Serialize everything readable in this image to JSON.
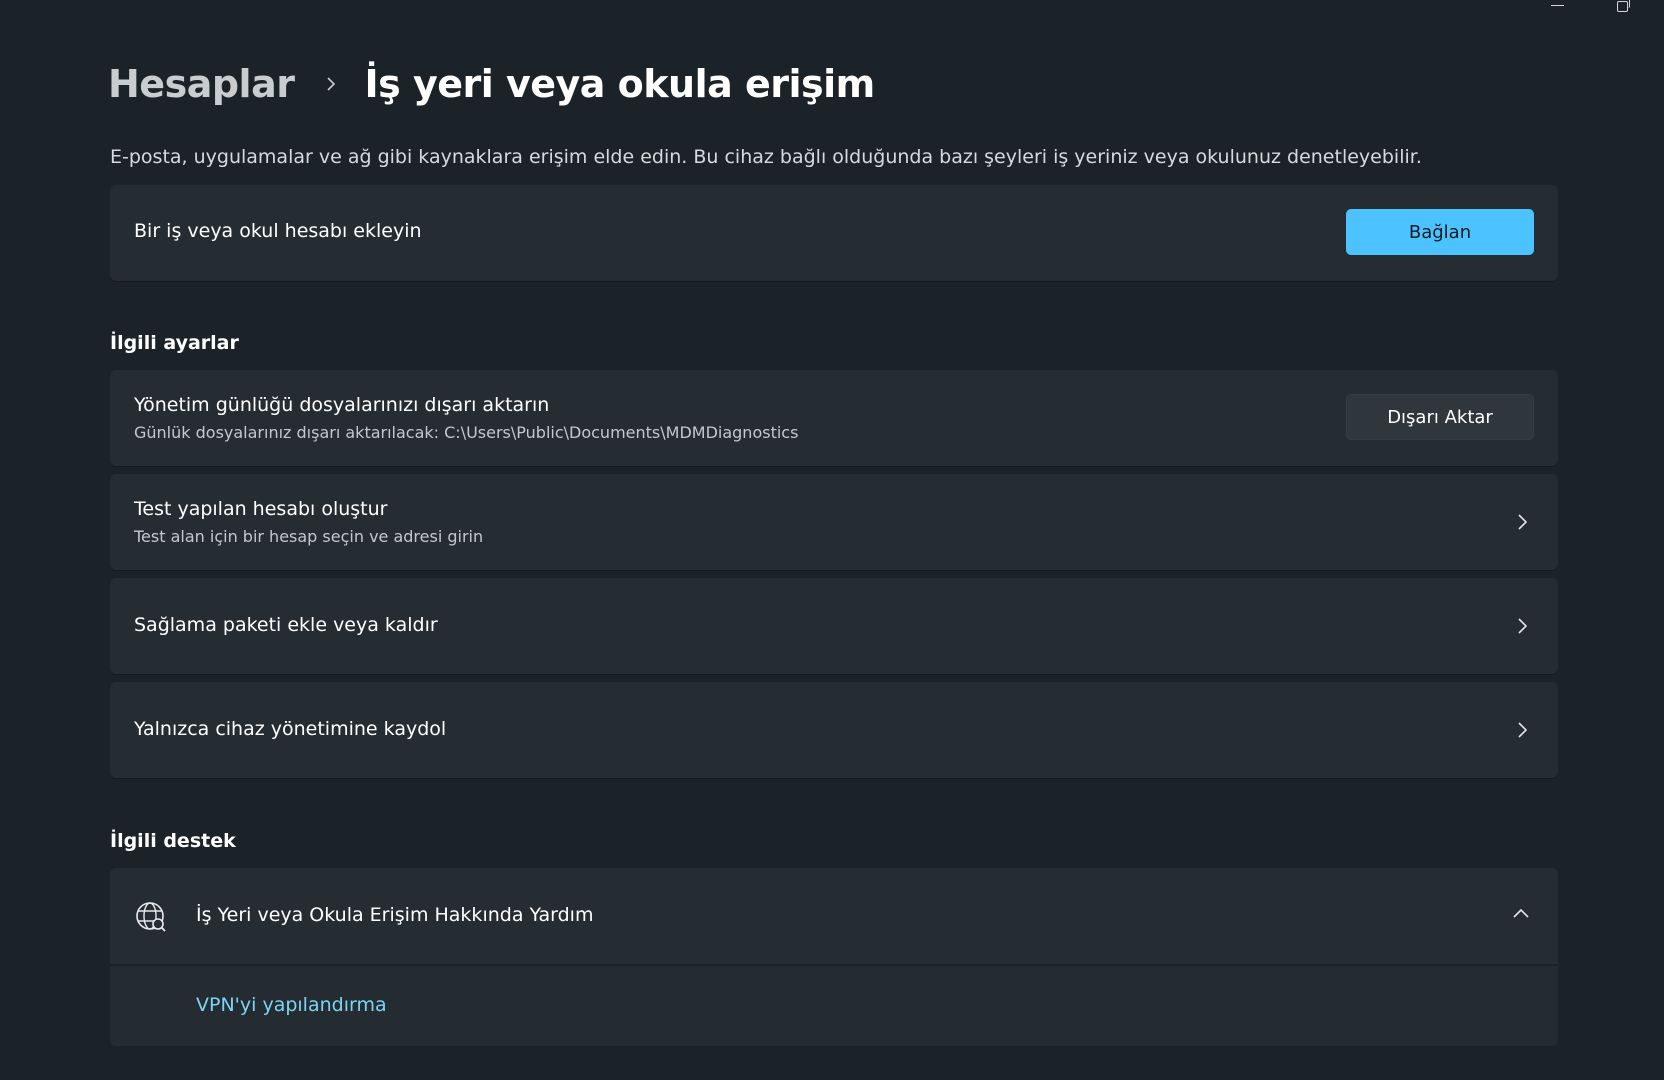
{
  "breadcrumb": {
    "parent": "Hesaplar",
    "current": "İş yeri veya okula erişim"
  },
  "description": "E-posta, uygulamalar ve ağ gibi kaynaklara erişim elde edin. Bu cihaz bağlı olduğunda bazı şeyleri iş yeriniz veya okulunuz denetleyebilir.",
  "add_account": {
    "label": "Bir iş veya okul hesabı ekleyin",
    "button": "Bağlan"
  },
  "related_settings": {
    "title": "İlgili ayarlar",
    "items": [
      {
        "title": "Yönetim günlüğü dosyalarınızı dışarı aktarın",
        "subtitle": "Günlük dosyalarınız dışarı aktarılacak: C:\\Users\\Public\\Documents\\MDMDiagnostics",
        "button": "Dışarı Aktar"
      },
      {
        "title": "Test yapılan hesabı oluştur",
        "subtitle": "Test alan için bir hesap seçin ve adresi girin"
      },
      {
        "title": "Sağlama paketi ekle veya kaldır"
      },
      {
        "title": "Yalnızca cihaz yönetimine kaydol"
      }
    ]
  },
  "related_support": {
    "title": "İlgili destek",
    "help_title": "İş Yeri veya Okula Erişim Hakkında Yardım",
    "links": [
      "VPN'yi yapılandırma"
    ]
  },
  "colors": {
    "accent": "#4cc2ff",
    "link": "#7cd4f5",
    "background": "#1c2328",
    "card": "#262d32"
  },
  "icons": {
    "window_minimize": "minimize-icon",
    "window_restore": "restore-icon",
    "breadcrumb_separator": "chevron-right-icon",
    "row_chevron": "chevron-right-icon",
    "help_icon": "globe-icon",
    "expander": "chevron-up-icon"
  }
}
